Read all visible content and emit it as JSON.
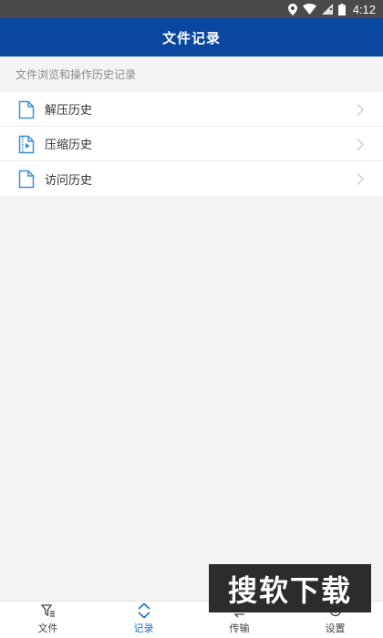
{
  "status_bar": {
    "time": "4:12",
    "icons": [
      "location-icon",
      "wifi-icon",
      "signal-icon",
      "battery-icon"
    ]
  },
  "header": {
    "title": "文件记录"
  },
  "section": {
    "caption": "文件浏览和操作历史记录"
  },
  "list": {
    "items": [
      {
        "label": "解压历史",
        "icon": "file-icon"
      },
      {
        "label": "压缩历史",
        "icon": "archive-file-icon"
      },
      {
        "label": "访问历史",
        "icon": "file-icon"
      }
    ]
  },
  "tabbar": {
    "tabs": [
      {
        "label": "文件",
        "icon": "filter-list-icon",
        "active": false
      },
      {
        "label": "记录",
        "icon": "expand-icon",
        "active": true
      },
      {
        "label": "传输",
        "icon": "transfer-icon",
        "active": false
      },
      {
        "label": "设置",
        "icon": "gear-icon",
        "active": false
      }
    ]
  },
  "watermark": {
    "text": "搜软下载"
  },
  "colors": {
    "header_bg": "#0a47a0",
    "status_bar_bg": "#4a4a4a",
    "page_bg": "#f4f4f4",
    "accent": "#1a6fd1",
    "icon_blue": "#3a8fd6"
  }
}
